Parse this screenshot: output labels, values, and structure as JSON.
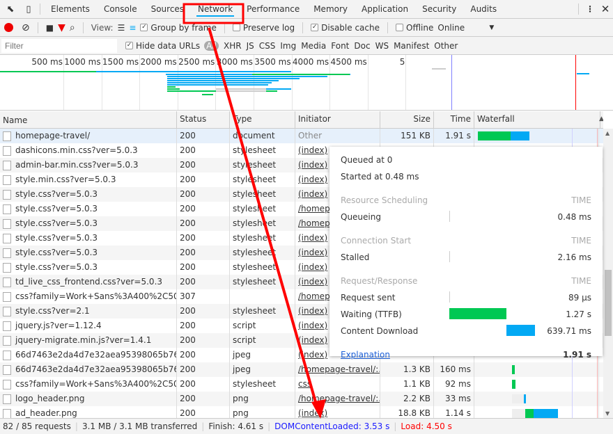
{
  "toolbar": {
    "tabs": [
      "Elements",
      "Console",
      "Sources",
      "Network",
      "Performance",
      "Memory",
      "Application",
      "Security",
      "Audits"
    ],
    "active_tab": "Network"
  },
  "controls": {
    "view_label": "View:",
    "group_by_frame": "Group by frame",
    "group_by_frame_checked": true,
    "preserve_log": "Preserve log",
    "preserve_log_checked": false,
    "disable_cache": "Disable cache",
    "disable_cache_checked": true,
    "offline": "Offline",
    "offline_checked": false,
    "throttle": "Online"
  },
  "filterbar": {
    "placeholder": "Filter",
    "hide_data_urls": "Hide data URLs",
    "hide_data_urls_checked": true,
    "types": [
      "All",
      "XHR",
      "JS",
      "CSS",
      "Img",
      "Media",
      "Font",
      "Doc",
      "WS",
      "Manifest",
      "Other"
    ]
  },
  "overview": {
    "ticks": [
      "500 ms",
      "1000 ms",
      "1500 ms",
      "2000 ms",
      "2500 ms",
      "3000 ms",
      "3500 ms",
      "4000 ms",
      "4500 ms",
      "5"
    ]
  },
  "table": {
    "columns": [
      "Name",
      "Status",
      "Type",
      "Initiator",
      "Size",
      "Time",
      "Waterfall"
    ],
    "rows": [
      {
        "name": "homepage-travel/",
        "status": "200",
        "type": "document",
        "initiator": "Other",
        "size": "151 KB",
        "time": "1.91 s"
      },
      {
        "name": "dashicons.min.css?ver=5.0.3",
        "status": "200",
        "type": "stylesheet",
        "initiator": "(index)"
      },
      {
        "name": "admin-bar.min.css?ver=5.0.3",
        "status": "200",
        "type": "stylesheet",
        "initiator": "(index)"
      },
      {
        "name": "style.min.css?ver=5.0.3",
        "status": "200",
        "type": "stylesheet",
        "initiator": "(index)"
      },
      {
        "name": "style.css?ver=5.0.3",
        "status": "200",
        "type": "stylesheet",
        "initiator": "(index)"
      },
      {
        "name": "style.css?ver=5.0.3",
        "status": "200",
        "type": "stylesheet",
        "initiator": "/homep"
      },
      {
        "name": "style.css?ver=5.0.3",
        "status": "200",
        "type": "stylesheet",
        "initiator": "/homep"
      },
      {
        "name": "style.css?ver=5.0.3",
        "status": "200",
        "type": "stylesheet",
        "initiator": "(index)"
      },
      {
        "name": "style.css?ver=5.0.3",
        "status": "200",
        "type": "stylesheet",
        "initiator": "(index)"
      },
      {
        "name": "style.css?ver=5.0.3",
        "status": "200",
        "type": "stylesheet",
        "initiator": "(index)"
      },
      {
        "name": "td_live_css_frontend.css?ver=5.0.3",
        "status": "200",
        "type": "stylesheet",
        "initiator": "(index)"
      },
      {
        "name": "css?family=Work+Sans%3A400%2C500...",
        "status": "307",
        "type": "",
        "initiator": "/homep"
      },
      {
        "name": "style.css?ver=2.1",
        "status": "200",
        "type": "stylesheet",
        "initiator": "(index)"
      },
      {
        "name": "jquery.js?ver=1.12.4",
        "status": "200",
        "type": "script",
        "initiator": "(index)"
      },
      {
        "name": "jquery-migrate.min.js?ver=1.4.1",
        "status": "200",
        "type": "script",
        "initiator": "(index)"
      },
      {
        "name": "66d7463e2da4d7e32aea95398065b76a?s...",
        "status": "200",
        "type": "jpeg",
        "initiator": "(index)"
      },
      {
        "name": "66d7463e2da4d7e32aea95398065b76a?s...",
        "status": "200",
        "type": "jpeg",
        "initiator": "/homepage-travel/:...",
        "size": "1.3 KB",
        "time": "160 ms"
      },
      {
        "name": "css?family=Work+Sans%3A400%2C500...",
        "status": "200",
        "type": "stylesheet",
        "initiator": "css",
        "size": "1.1 KB",
        "time": "92 ms"
      },
      {
        "name": "logo_header.png",
        "status": "200",
        "type": "png",
        "initiator": "/homepage-travel/:...",
        "size": "2.2 KB",
        "time": "33 ms"
      },
      {
        "name": "ad_header.png",
        "status": "200",
        "type": "png",
        "initiator": "(index)",
        "size": "18.8 KB",
        "time": "1.14 s"
      }
    ]
  },
  "timing": {
    "queued": "Queued at 0",
    "started": "Started at 0.48 ms",
    "time_label": "TIME",
    "sections": [
      {
        "title": "Resource Scheduling",
        "items": [
          {
            "label": "Queueing",
            "value": "0.48 ms"
          }
        ]
      },
      {
        "title": "Connection Start",
        "items": [
          {
            "label": "Stalled",
            "value": "2.16 ms"
          }
        ]
      },
      {
        "title": "Request/Response",
        "items": [
          {
            "label": "Request sent",
            "value": "89 µs"
          },
          {
            "label": "Waiting (TTFB)",
            "value": "1.27 s"
          },
          {
            "label": "Content Download",
            "value": "639.71 ms"
          }
        ]
      }
    ],
    "explanation": "Explanation",
    "total": "1.91 s"
  },
  "status": {
    "requests": "82 / 85 requests",
    "transferred": "3.1 MB / 3.1 MB transferred",
    "finish": "Finish: 4.61 s",
    "dcl": "DOMContentLoaded: 3.53 s",
    "load": "Load: 4.50 s"
  },
  "colors": {
    "accent": "#03a9f4",
    "ttfb": "#00c853",
    "download": "#03a9f4",
    "dcl": "#0000ff",
    "load": "#ff0000",
    "annotation": "#ff0000"
  }
}
